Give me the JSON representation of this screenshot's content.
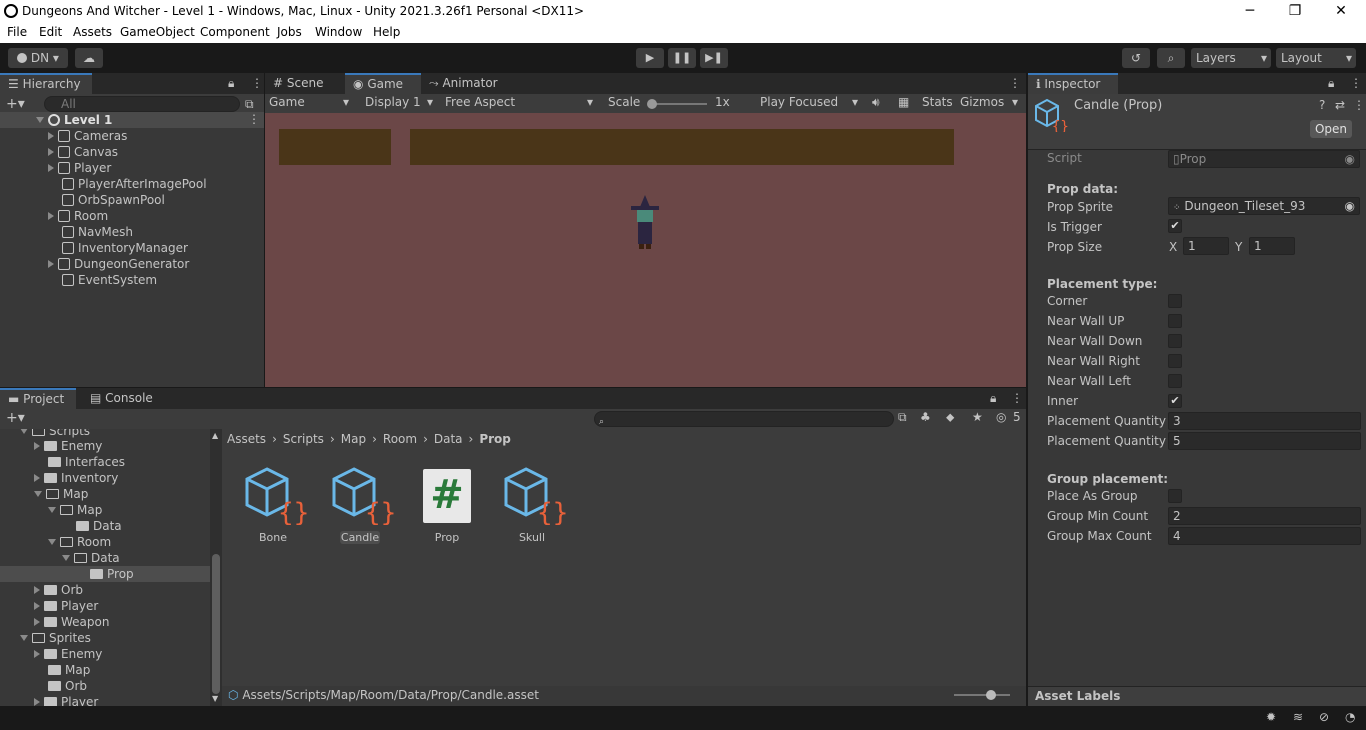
{
  "window": {
    "title": "Dungeons And Witcher - Level 1 - Windows, Mac, Linux - Unity 2021.3.26f1 Personal <DX11>",
    "minimize": "─",
    "maximize": "❐",
    "close": "✕"
  },
  "menu": [
    "File",
    "Edit",
    "Assets",
    "GameObject",
    "Component",
    "Jobs",
    "Window",
    "Help"
  ],
  "toolbar": {
    "account": "DN",
    "layers": "Layers",
    "layout": "Layout"
  },
  "hierarchy": {
    "tab": "Hierarchy",
    "search_placeholder": "All",
    "scene": "Level 1",
    "items": [
      "Cameras",
      "Canvas",
      "Player",
      "PlayerAfterImagePool",
      "OrbSpawnPool",
      "Room",
      "NavMesh",
      "InventoryManager",
      "DungeonGenerator",
      "EventSystem"
    ]
  },
  "game": {
    "tabs": [
      "Scene",
      "Game",
      "Animator"
    ],
    "display_mode": "Game",
    "display": "Display 1",
    "aspect": "Free Aspect",
    "scale_label": "Scale",
    "scale_value": "1x",
    "play_mode": "Play Focused",
    "stats": "Stats",
    "gizmos": "Gizmos",
    "bg_color": "#6b4747",
    "bar_color": "#4a3518"
  },
  "project": {
    "tabs": [
      "Project",
      "Console"
    ],
    "hidden_count": "5",
    "tree": [
      {
        "label": "Scripts",
        "depth": 1,
        "open": true
      },
      {
        "label": "Enemy",
        "depth": 2,
        "open": false
      },
      {
        "label": "Interfaces",
        "depth": 2,
        "open": null
      },
      {
        "label": "Inventory",
        "depth": 2,
        "open": false
      },
      {
        "label": "Map",
        "depth": 2,
        "open": true
      },
      {
        "label": "Map",
        "depth": 3,
        "open": true
      },
      {
        "label": "Data",
        "depth": 4,
        "open": null
      },
      {
        "label": "Room",
        "depth": 3,
        "open": true
      },
      {
        "label": "Data",
        "depth": 4,
        "open": true
      },
      {
        "label": "Prop",
        "depth": 5,
        "open": null
      },
      {
        "label": "Orb",
        "depth": 2,
        "open": false
      },
      {
        "label": "Player",
        "depth": 2,
        "open": false
      },
      {
        "label": "Weapon",
        "depth": 2,
        "open": false
      },
      {
        "label": "Sprites",
        "depth": 1,
        "open": true
      },
      {
        "label": "Enemy",
        "depth": 2,
        "open": false
      },
      {
        "label": "Map",
        "depth": 2,
        "open": null
      },
      {
        "label": "Orb",
        "depth": 2,
        "open": null
      },
      {
        "label": "Player",
        "depth": 2,
        "open": false
      }
    ],
    "breadcrumb": [
      "Assets",
      "Scripts",
      "Map",
      "Room",
      "Data",
      "Prop"
    ],
    "assets": [
      {
        "label": "Bone",
        "type": "so"
      },
      {
        "label": "Candle",
        "type": "so"
      },
      {
        "label": "Prop",
        "type": "cs"
      },
      {
        "label": "Skull",
        "type": "so"
      }
    ],
    "path": "Assets/Scripts/Map/Room/Data/Prop/Candle.asset"
  },
  "inspector": {
    "tab": "Inspector",
    "object_name": "Candle (Prop)",
    "open_button": "Open",
    "script_label": "Script",
    "script_value": "Prop",
    "section_prop": "Prop data:",
    "prop_sprite_label": "Prop Sprite",
    "prop_sprite_value": "Dungeon_Tileset_93",
    "is_trigger_label": "Is Trigger",
    "is_trigger": true,
    "prop_size_label": "Prop Size",
    "prop_size_x_label": "X",
    "prop_size_x": "1",
    "prop_size_y_label": "Y",
    "prop_size_y": "1",
    "section_placement": "Placement type:",
    "placement": [
      {
        "label": "Corner",
        "checked": false
      },
      {
        "label": "Near Wall UP",
        "checked": false
      },
      {
        "label": "Near Wall Down",
        "checked": false
      },
      {
        "label": "Near Wall Right",
        "checked": false
      },
      {
        "label": "Near Wall Left",
        "checked": false
      },
      {
        "label": "Inner",
        "checked": true
      }
    ],
    "qty_min_label": "Placement Quantity M",
    "qty_min": "3",
    "qty_max_label": "Placement Quantity M",
    "qty_max": "5",
    "section_group": "Group placement:",
    "place_as_group_label": "Place As Group",
    "place_as_group": false,
    "group_min_label": "Group Min Count",
    "group_min": "2",
    "group_max_label": "Group Max Count",
    "group_max": "4",
    "asset_labels": "Asset Labels"
  },
  "check_glyph": "✔"
}
